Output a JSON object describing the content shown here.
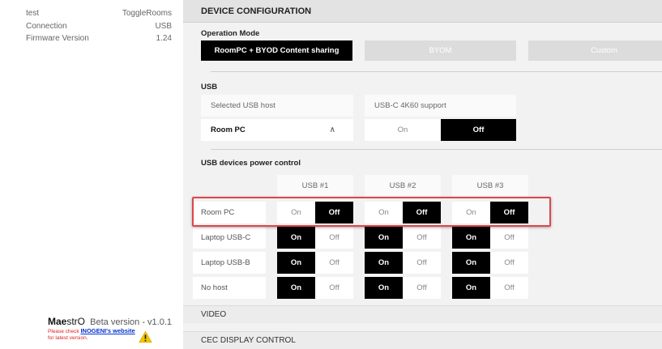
{
  "sidebar": {
    "info": [
      {
        "label": "test",
        "value": "ToggleRooms"
      },
      {
        "label": "Connection",
        "value": "USB"
      },
      {
        "label": "Firmware Version",
        "value": "1.24"
      }
    ],
    "brand": {
      "name_bold": "Mae",
      "name_rest": "strO",
      "version": "Beta version - v1.0.1"
    },
    "update_note": {
      "prefix": "Please check ",
      "link": "INOGENI's website",
      "suffix": "for latest version."
    }
  },
  "main": {
    "section_title": "DEVICE CONFIGURATION",
    "operation_mode": {
      "title": "Operation Mode",
      "modes": [
        {
          "label": "RoomPC + BYOD Content sharing",
          "active": true
        },
        {
          "label": "BYOM",
          "active": false
        },
        {
          "label": "Custom",
          "active": false
        }
      ]
    },
    "usb": {
      "title": "USB",
      "selected_host_label": "Selected USB host",
      "selected_host_value": "Room PC",
      "k60_label": "USB-C 4K60 support",
      "k60_on": "On",
      "k60_off": "Off",
      "k60_state": "off"
    },
    "power_control": {
      "title": "USB devices power control",
      "columns": [
        "USB #1",
        "USB #2",
        "USB #3"
      ],
      "on_label": "On",
      "off_label": "Off",
      "rows": [
        {
          "label": "Room PC",
          "states": [
            "off",
            "off",
            "off"
          ]
        },
        {
          "label": "Laptop USB-C",
          "states": [
            "on",
            "on",
            "on"
          ]
        },
        {
          "label": "Laptop USB-B",
          "states": [
            "on",
            "on",
            "on"
          ]
        },
        {
          "label": "No host",
          "states": [
            "on",
            "on",
            "on"
          ]
        }
      ]
    },
    "collapsed_sections": [
      "VIDEO",
      "CEC DISPLAY CONTROL"
    ]
  },
  "colors": {
    "highlight": "#e0454a",
    "active": "#000000",
    "warning": "#f5c400"
  }
}
